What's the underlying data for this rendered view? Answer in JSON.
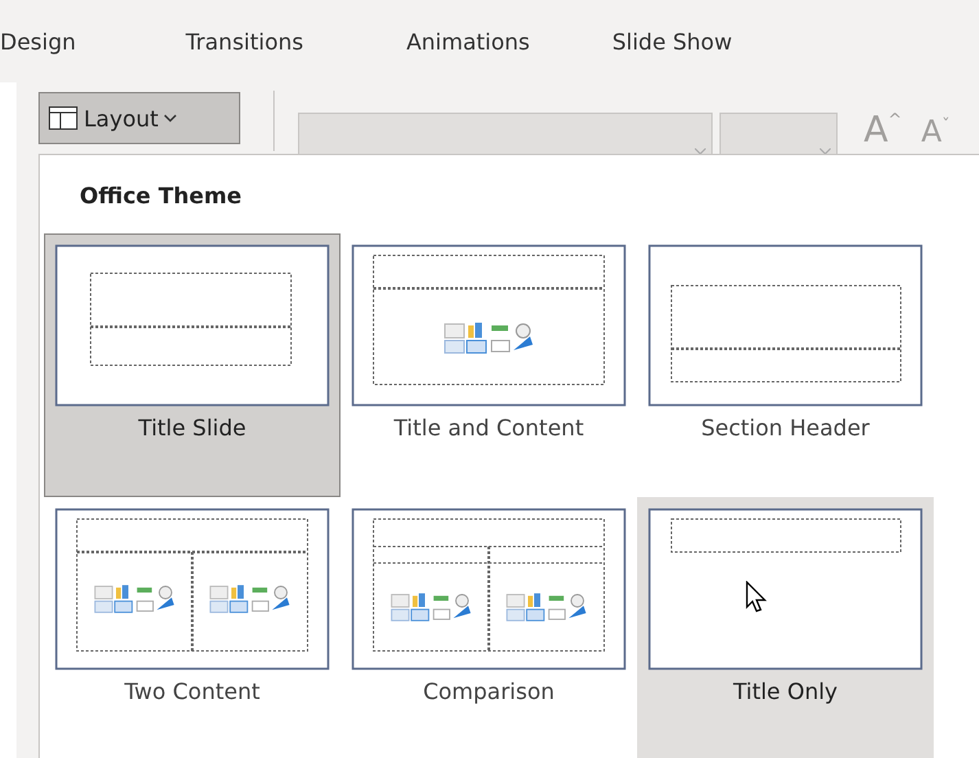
{
  "tabs": [
    {
      "label": "Design"
    },
    {
      "label": "Transitions"
    },
    {
      "label": "Animations"
    },
    {
      "label": "Slide Show"
    }
  ],
  "ribbon": {
    "layout_button": {
      "label": "Layout"
    },
    "font_buttons": [
      {
        "label": "A",
        "mark": "^"
      },
      {
        "label": "A",
        "mark": "ˇ"
      }
    ]
  },
  "layout_menu": {
    "heading": "Office Theme",
    "layouts": [
      {
        "label": "Title Slide",
        "kind": "title",
        "selected": true,
        "hovered": false
      },
      {
        "label": "Title and Content",
        "kind": "content",
        "selected": false,
        "hovered": false
      },
      {
        "label": "Section Header",
        "kind": "section",
        "selected": false,
        "hovered": false
      },
      {
        "label": "Two Content",
        "kind": "two",
        "selected": false,
        "hovered": false
      },
      {
        "label": "Comparison",
        "kind": "comparison",
        "selected": false,
        "hovered": false
      },
      {
        "label": "Title Only",
        "kind": "titleonly",
        "selected": false,
        "hovered": true
      }
    ]
  }
}
